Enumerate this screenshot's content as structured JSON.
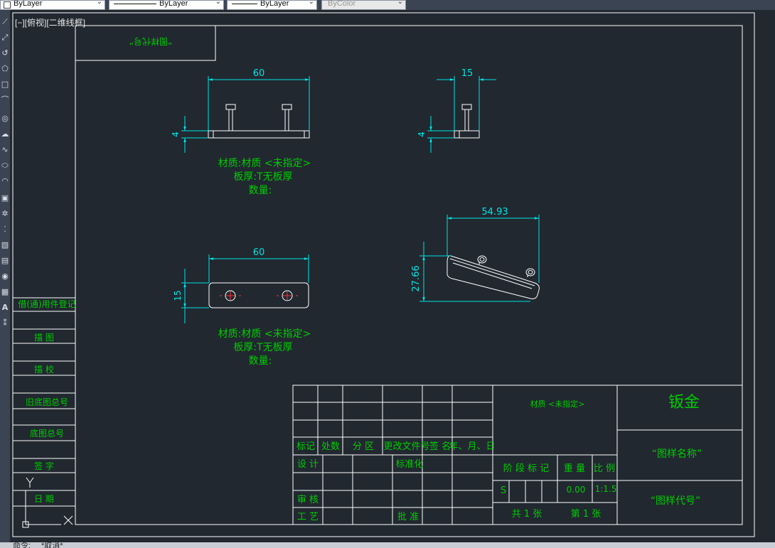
{
  "toolbar": {
    "layer_combo": "ByLayer",
    "linetype_combo": "ByLayer",
    "lineweight_combo": "ByLayer",
    "plotstyle_combo": "ByColor"
  },
  "viewport": {
    "label": "[−][俯视][二维线框]"
  },
  "title_box": {
    "text": "“图样代号”"
  },
  "views": {
    "front_dim": "60",
    "front_thick": "4",
    "side_dim": "15",
    "side_thick": "4",
    "top_dim": "60",
    "top_height": "15",
    "iso_width": "54.93",
    "iso_height": "27.66"
  },
  "notes": {
    "material_1": "材质:材质 <未指定>",
    "thickness_1": "板厚:T无板厚",
    "qty_1": "数量:",
    "material_2": "材质:材质 <未指定>",
    "thickness_2": "板厚:T无板厚",
    "qty_2": "数量:"
  },
  "side_table": [
    "借(通)用件登记",
    "描  图",
    "描  校",
    "旧底图总号",
    "底图总号",
    "签  字",
    "日  期"
  ],
  "title_block": {
    "h_mark": "标记",
    "h_count": "处数",
    "h_zone": "分 区",
    "h_doc": "更改文件号",
    "h_sign": "签 名",
    "h_date": "年、月、日",
    "design": "设 计",
    "standard": "标准化",
    "review": "审 核",
    "process": "工 艺",
    "approve": "批 准",
    "material": "材质 <未指定>",
    "stage": "阶 段 标 记",
    "weight": "重 量",
    "scale": "比 例",
    "s_mark": "S",
    "weight_val": "0.00",
    "scale_val": "1:1.5",
    "sheets_total": "共 1 张",
    "sheet_no": "第 1 张",
    "name_big": "钣金",
    "drawing_name": "“图样名称”",
    "drawing_code": "“图样代号”"
  },
  "command": {
    "prefix": "命令:",
    "text": "*取消*"
  },
  "colors": {
    "line": "#ffffff",
    "text": "#00cc00",
    "dim": "#00e5e5",
    "bg": "#212830"
  }
}
